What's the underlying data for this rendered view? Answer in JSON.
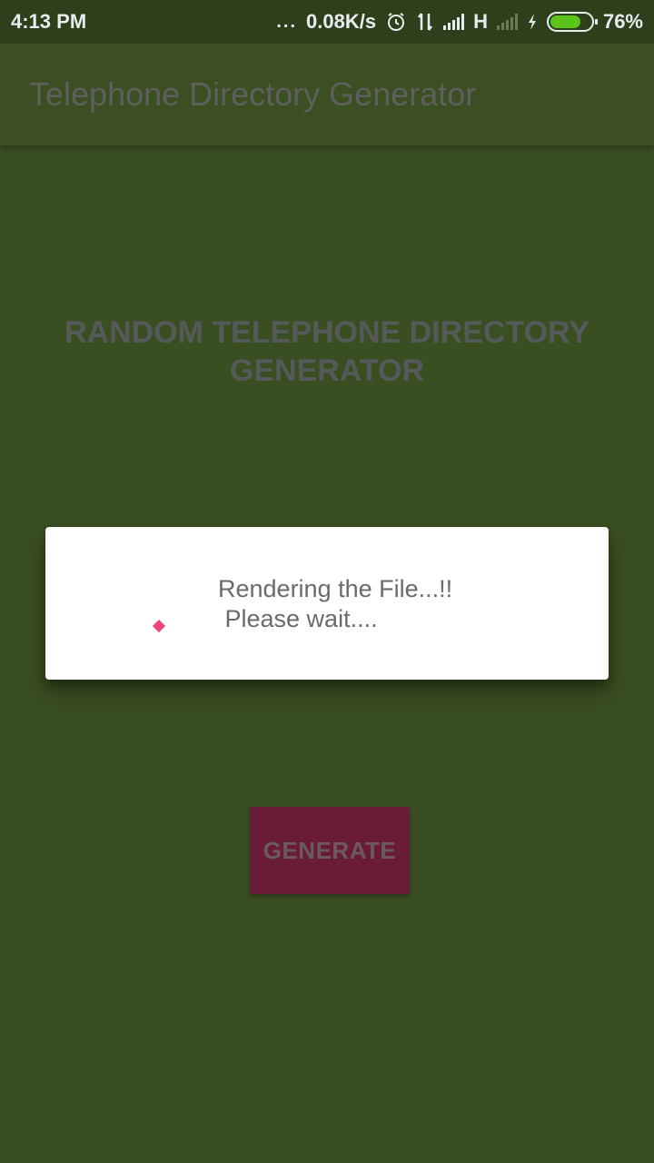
{
  "status_bar": {
    "time": "4:13 PM",
    "dots": "...",
    "speed": "0.08K/s",
    "network_type": "H",
    "battery_percent": "76%",
    "battery_level": 0.76,
    "icons": [
      "alarm-icon",
      "data-transfer-icon",
      "signal-icon",
      "no-signal-icon",
      "charging-icon",
      "battery-icon"
    ]
  },
  "app_bar": {
    "title": "Telephone Directory Generator"
  },
  "main": {
    "headline": "RANDOM TELEPHONE DIRECTORY\nGENERATOR",
    "generate_label": "GENERATE"
  },
  "dialog": {
    "message_line1": "Rendering the File...!!",
    "message_line2": " Please wait...."
  },
  "colors": {
    "background": "#3a4f21",
    "app_bar": "#3b4f22",
    "button": "#6a1b38",
    "spinner": "#f0467f"
  }
}
